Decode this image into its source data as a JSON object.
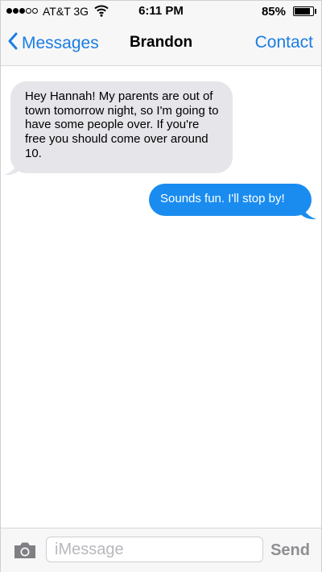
{
  "status_bar": {
    "signal_dots": 5,
    "signal_filled": 3,
    "carrier": "AT&T 3G",
    "time": "6:11 PM",
    "battery_text": "85%",
    "battery_level": 0.85,
    "icons": [
      "wifi-icon",
      "battery-icon"
    ]
  },
  "nav": {
    "back_label": "Messages",
    "title": "Brandon",
    "contact_label": "Contact",
    "accent_color": "#1a7de2"
  },
  "messages": [
    {
      "direction": "incoming",
      "text": "Hey Hannah! My parents are out of town tomorrow night, so I'm going to have some people over. If you're free you should come over around 10.",
      "bubble_color": "#e5e5ea"
    },
    {
      "direction": "outgoing",
      "text": "Sounds fun. I'll stop by!",
      "bubble_color": "#1a8cf0"
    }
  ],
  "composer": {
    "placeholder": "iMessage",
    "value": "",
    "send_label": "Send",
    "camera_icon": "camera-icon"
  }
}
